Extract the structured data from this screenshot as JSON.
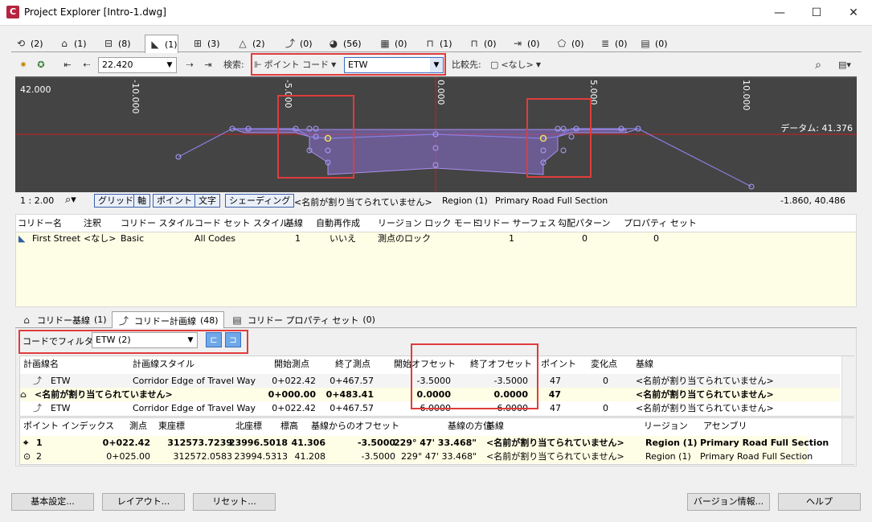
{
  "window": {
    "title": "Project Explorer [Intro-1.dwg]",
    "app_letter": "C",
    "minimize": "—",
    "maximize": "☐",
    "close": "✕"
  },
  "object_tabs": [
    {
      "icon": "alignment-icon",
      "glyph": "⟲",
      "count": "(2)"
    },
    {
      "icon": "site-icon",
      "glyph": "⌂",
      "count": "(1)"
    },
    {
      "icon": "profile-icon",
      "glyph": "⊟",
      "count": "(8)"
    },
    {
      "icon": "corridor-icon",
      "glyph": "◣",
      "count": "(1)"
    },
    {
      "icon": "assembly-icon",
      "glyph": "⊞",
      "count": "(3)"
    },
    {
      "icon": "surface-icon",
      "glyph": "△",
      "count": "(2)"
    },
    {
      "icon": "feature-line-icon",
      "glyph": "⤴",
      "count": "(0)"
    },
    {
      "icon": "pipe-network-icon",
      "glyph": "◕",
      "count": "(56)"
    },
    {
      "icon": "parcel-icon",
      "glyph": "▦",
      "count": "(0)"
    },
    {
      "icon": "structure-icon",
      "glyph": "⊓",
      "count": "(1)"
    },
    {
      "icon": "pressure-icon",
      "glyph": "⊓",
      "count": "(0)"
    },
    {
      "icon": "sample-line-icon",
      "glyph": "⇥",
      "count": "(0)"
    },
    {
      "icon": "view-frame-icon",
      "glyph": "⬠",
      "count": "(0)"
    },
    {
      "icon": "sheet-icon",
      "glyph": "≣",
      "count": "(0)"
    },
    {
      "icon": "data-shortcut-icon",
      "glyph": "▤",
      "count": "(0)"
    }
  ],
  "toolbar": {
    "station_value": "22.420",
    "search_label": "検索:",
    "search_type": "ポイント コード",
    "search_value": "ETW",
    "compare_label": "比較先:",
    "compare_value": "<なし>"
  },
  "viewport": {
    "y_label": "42.000",
    "x_ticks": [
      "-10.000",
      "-5.000",
      "0.000",
      "5.000",
      "10.000"
    ],
    "datum_label": "データム: 41.376"
  },
  "viewbar": {
    "scale": "1 : 2.00",
    "buttons": [
      "グリッド",
      "軸",
      "ポイント",
      "文字",
      "シェーディング"
    ],
    "baseline": "<名前が割り当てられていません>",
    "region": "Region (1)",
    "assembly": "Primary Road Full Section",
    "coords": "-1.860, 40.486"
  },
  "corridor_table": {
    "headers": [
      "コリドー名",
      "注釈",
      "コリドー スタイル",
      "コード セット スタイル",
      "基線",
      "自動再作成",
      "リージョン ロック モード",
      "コリドー サーフェス",
      "勾配パターン",
      "プロパティ セット"
    ],
    "row": [
      "First Street",
      "<なし>",
      "Basic",
      "All Codes",
      "1",
      "いいえ",
      "測点のロック",
      "1",
      "0",
      "0"
    ]
  },
  "bottom_tabs": [
    {
      "label": "コリドー基線",
      "count": "(1)",
      "icon": "baseline-icon"
    },
    {
      "label": "コリドー計画線",
      "count": "(48)",
      "icon": "feature-line-icon"
    },
    {
      "label": "コリドー プロパティ セット",
      "count": "(0)",
      "icon": "property-set-icon"
    }
  ],
  "filter": {
    "label": "コードでフィルタ:",
    "value": "ETW  (2)"
  },
  "feature_lines": {
    "headers": [
      "計画線名",
      "計画線スタイル",
      "開始測点",
      "終了測点",
      "開始オフセット",
      "終了オフセット",
      "ポイント",
      "変化点",
      "基線"
    ],
    "rows": [
      {
        "name": "ETW",
        "style": "Corridor Edge of Travel Way",
        "start": "0+022.42",
        "end": "0+467.57",
        "soff": "-3.5000",
        "eoff": "-3.5000",
        "pts": "47",
        "vert": "0",
        "base": "<名前が割り当てられていません>"
      },
      {
        "name": "<名前が割り当てられていません>",
        "style": "",
        "start": "0+000.00",
        "end": "0+483.41",
        "soff": "0.0000",
        "eoff": "0.0000",
        "pts": "47",
        "vert": "",
        "base": "<名前が割り当てられていません>"
      },
      {
        "name": "ETW",
        "style": "Corridor Edge of Travel Way",
        "start": "0+022.42",
        "end": "0+467.57",
        "soff": "6.0000",
        "eoff": "6.0000",
        "pts": "47",
        "vert": "0",
        "base": "<名前が割り当てられていません>"
      }
    ]
  },
  "points": {
    "headers": [
      "ポイント インデックス",
      "測点",
      "東座標",
      "北座標",
      "標高",
      "基線からのオフセット",
      "基線の方位",
      "基線",
      "リージョン",
      "アセンブリ"
    ],
    "rows": [
      {
        "idx": "1",
        "sta": "0+022.42",
        "east": "312573.7239",
        "north": "23996.5018",
        "elev": "41.306",
        "off": "-3.5000",
        "brg": "229° 47' 33.468\"",
        "base": "<名前が割り当てられていません>",
        "reg": "Region (1)",
        "asm": "Primary Road Full Section"
      },
      {
        "idx": "2",
        "sta": "0+025.00",
        "east": "312572.0583",
        "north": "23994.5313",
        "elev": "41.208",
        "off": "-3.5000",
        "brg": "229° 47' 33.468\"",
        "base": "<名前が割り当てられていません>",
        "reg": "Region (1)",
        "asm": "Primary Road Full Section"
      }
    ]
  },
  "footer": {
    "settings": "基本設定...",
    "layout": "レイアウト...",
    "reset": "リセット...",
    "version": "バージョン情報...",
    "help": "ヘルプ"
  }
}
